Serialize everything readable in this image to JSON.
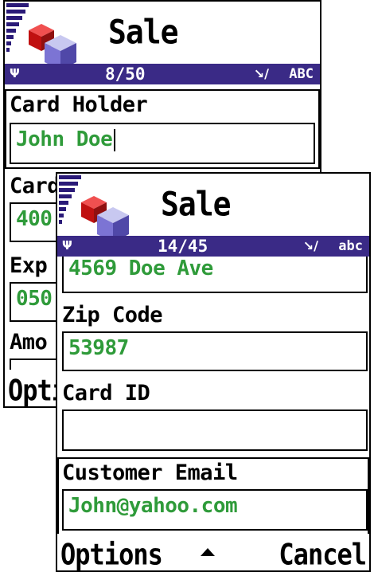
{
  "back": {
    "title": "Sale",
    "status": {
      "signal": "Ψ",
      "counter": "8/50",
      "pen_icon": "pen-icon",
      "mode": "ABC"
    },
    "fields": [
      {
        "label": "Card Holder",
        "value": "John Doe"
      },
      {
        "label": "Card",
        "value": "400"
      },
      {
        "label": "Exp",
        "value": "050"
      },
      {
        "label": "Amo",
        "value": ""
      }
    ],
    "softkey_left": "Opti"
  },
  "front": {
    "title": "Sale",
    "status": {
      "signal": "Ψ",
      "counter": "14/45",
      "pen_icon": "pen-icon",
      "mode": "abc"
    },
    "address_value": "4569 Doe Ave",
    "fields": [
      {
        "label": "Zip Code",
        "value": "53987"
      },
      {
        "label": "Card ID",
        "value": ""
      },
      {
        "label": "Customer Email",
        "value": "John@yahoo.com"
      }
    ],
    "softkey_left": "Options",
    "softkey_right": "Cancel"
  },
  "colors": {
    "status_bar": "#3a2a86",
    "field_text": "#2f9b3a"
  }
}
